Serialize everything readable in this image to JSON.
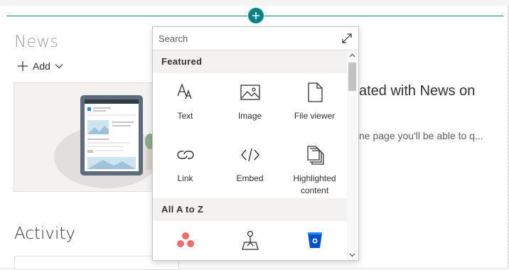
{
  "news": {
    "title": "News",
    "add_label": "Add",
    "banner_heading": "ated with News on",
    "banner_body": "ne page you'll be able to q..."
  },
  "activity": {
    "title": "Activity"
  },
  "toolbox": {
    "search_placeholder": "Search",
    "featured_header": "Featured",
    "featured_items": [
      {
        "label": "Text",
        "icon": "text-icon"
      },
      {
        "label": "Image",
        "icon": "image-icon"
      },
      {
        "label": "File viewer",
        "icon": "file-icon"
      },
      {
        "label": "Link",
        "icon": "link-icon"
      },
      {
        "label": "Embed",
        "icon": "embed-icon"
      },
      {
        "label": "Highlighted content",
        "icon": "highlighted-content-icon"
      }
    ],
    "all_header": "All A to Z",
    "all_items": [
      {
        "label": "",
        "icon": "asana-icon"
      },
      {
        "label": "",
        "icon": "bing-maps-icon"
      },
      {
        "label": "",
        "icon": "bitbucket-icon"
      }
    ]
  },
  "colors": {
    "accent": "#038387",
    "asana": "#f06a6a",
    "bitbucket": "#0052cc"
  }
}
